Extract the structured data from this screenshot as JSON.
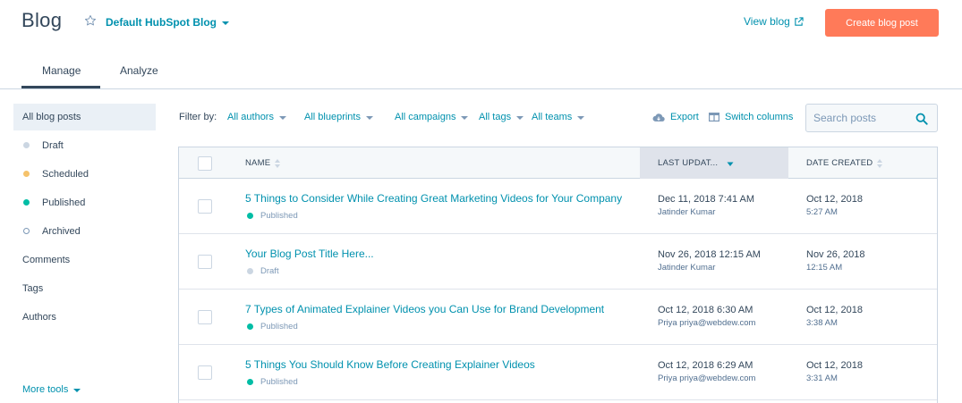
{
  "header": {
    "title": "Blog",
    "blog_selector": "Default HubSpot Blog",
    "view_blog": "View blog",
    "create_button": "Create blog post"
  },
  "tabs": [
    {
      "label": "Manage",
      "active": true
    },
    {
      "label": "Analyze",
      "active": false
    }
  ],
  "sidebar": {
    "items": [
      {
        "label": "All blog posts"
      },
      {
        "label": "Draft",
        "dot": "#cbd6e2"
      },
      {
        "label": "Scheduled",
        "dot": "#f5c26b"
      },
      {
        "label": "Published",
        "dot": "#00bda5"
      },
      {
        "label": "Archived",
        "dot": "hollow"
      },
      {
        "label": "Comments"
      },
      {
        "label": "Tags"
      },
      {
        "label": "Authors"
      }
    ],
    "more_tools": "More tools"
  },
  "filters": {
    "label": "Filter by:",
    "items": [
      "All authors",
      "All blueprints",
      "All campaigns",
      "All tags",
      "All teams"
    ],
    "export": "Export",
    "switch_columns": "Switch columns",
    "search_placeholder": "Search posts"
  },
  "table": {
    "columns": {
      "name": "NAME",
      "last_updated": "LAST UPDAT...",
      "date_created": "DATE CREATED"
    },
    "rows": [
      {
        "title": "5 Things to Consider While Creating Great Marketing Videos for Your Company",
        "status": "Published",
        "status_color": "#00bda5",
        "updated": "Dec 11, 2018 7:41 AM",
        "author": "Jatinder Kumar",
        "created_date": "Oct 12, 2018",
        "created_time": "5:27 AM"
      },
      {
        "title": "Your Blog Post Title Here...",
        "status": "Draft",
        "status_color": "#cbd6e2",
        "updated": "Nov 26, 2018 12:15 AM",
        "author": "Jatinder Kumar",
        "created_date": "Nov 26, 2018",
        "created_time": "12:15 AM"
      },
      {
        "title": "7 Types of Animated Explainer Videos you Can Use for Brand Development",
        "status": "Published",
        "status_color": "#00bda5",
        "updated": "Oct 12, 2018 6:30 AM",
        "author": "Priya priya@webdew.com",
        "created_date": "Oct 12, 2018",
        "created_time": "3:38 AM"
      },
      {
        "title": "5 Things You Should Know Before Creating Explainer Videos",
        "status": "Published",
        "status_color": "#00bda5",
        "updated": "Oct 12, 2018 6:29 AM",
        "author": "Priya priya@webdew.com",
        "created_date": "Oct 12, 2018",
        "created_time": "3:31 AM"
      }
    ]
  },
  "colors": {
    "accent": "#0091ae",
    "primary_button": "#ff7a59",
    "text": "#33475b"
  }
}
